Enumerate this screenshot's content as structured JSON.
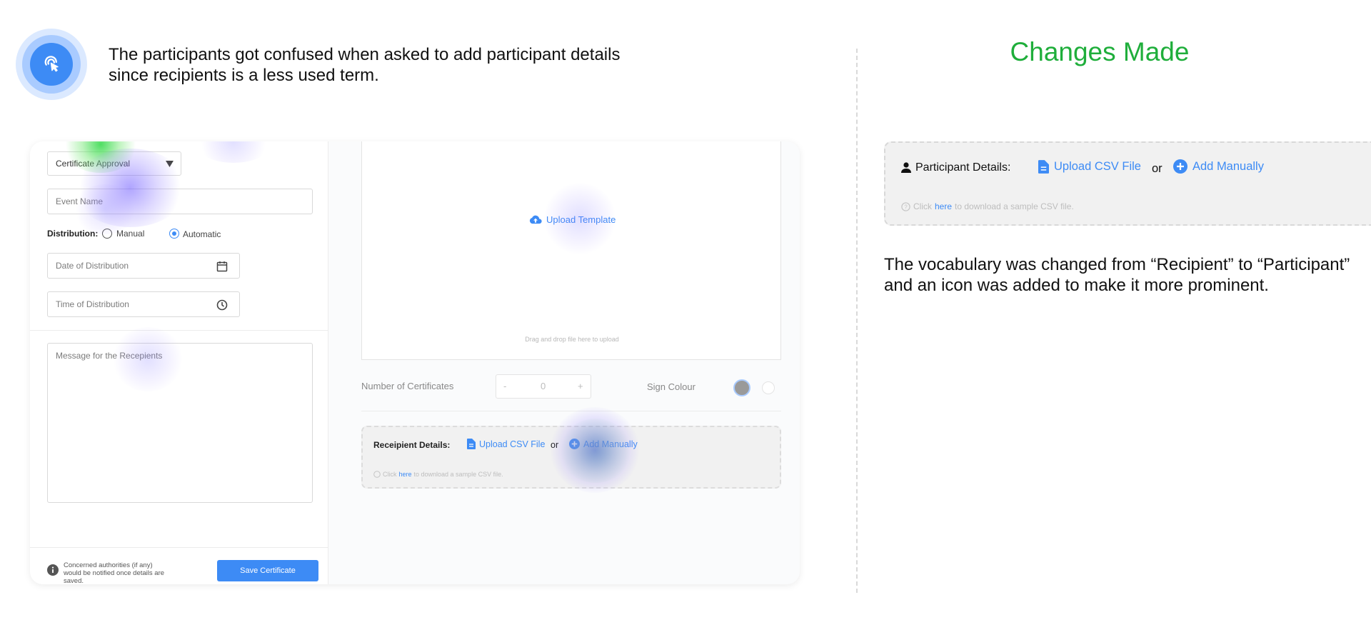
{
  "finding": {
    "text": "The participants got confused when asked to add participant details since recipients is a less used term."
  },
  "badge": {
    "icon": "touch-click-icon"
  },
  "changes": {
    "title": "Changes Made",
    "explanation": "The vocabulary was changed from “Recipient” to “Participant” and an icon was added to make it more prominent."
  },
  "new_card": {
    "label": "Participant Details:",
    "upload_csv": "Upload CSV File",
    "or": "or",
    "add_manually": "Add Manually",
    "hint_prefix": "Click",
    "hint_link": "here",
    "hint_suffix": "to download a sample CSV file."
  },
  "mock": {
    "certificate_type": "Certificate Approval",
    "event_name_placeholder": "Event Name",
    "distribution_label": "Distribution:",
    "distribution_manual": "Manual",
    "distribution_automatic": "Automatic",
    "date_placeholder": "Date of Distribution",
    "time_placeholder": "Time of Distribution",
    "message_placeholder": "Message for the Recepients",
    "notice": "Concerned authorities (if any) would be notified once details are saved.",
    "save_button": "Save Certificate",
    "upload_template": "Upload Template",
    "drag_drop": "Drag and drop file here to upload",
    "num_certificates_label": "Number of Certificates",
    "num_minus": "-",
    "num_value": "0",
    "num_plus": "+",
    "sign_colour_label": "Sign Colour",
    "old_card": {
      "label": "Receipient Details:",
      "upload_csv": "Upload CSV File",
      "or": "or",
      "add_manually": "Add Manually",
      "hint_prefix": "Click",
      "hint_link": "here",
      "hint_suffix": "to download a sample CSV file."
    }
  },
  "colors": {
    "accent_blue": "#3d8bf5",
    "title_green": "#1fae3b",
    "card_bg": "#f1f1f1"
  }
}
